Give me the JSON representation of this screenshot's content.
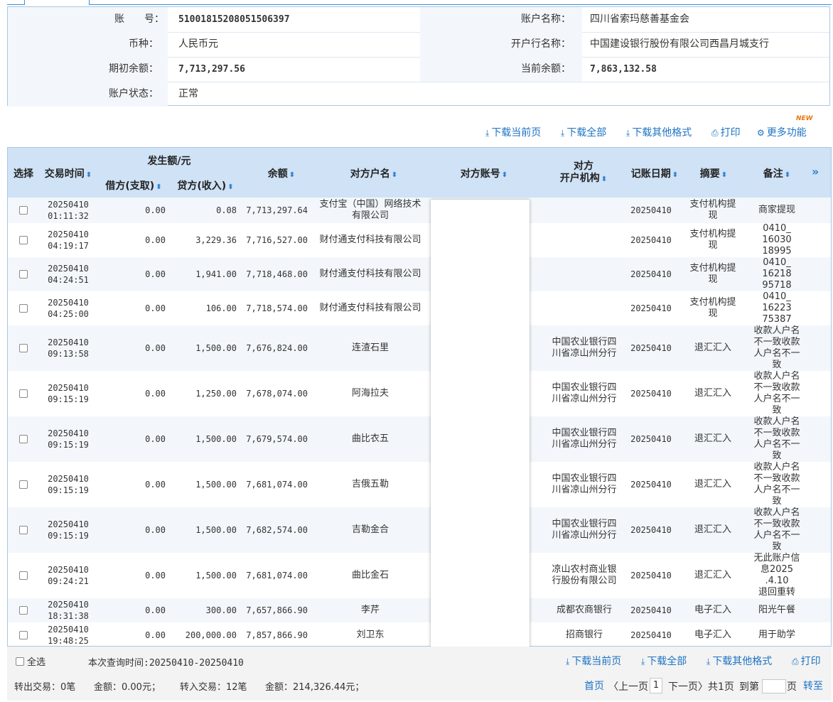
{
  "account": {
    "row1": {
      "l1": "账　　号：",
      "v1": "51001815208051506397",
      "l2": "账户名称：",
      "v2": "四川省索玛慈善基金会"
    },
    "row2": {
      "l1": "币种：",
      "v1": "人民币元",
      "l2": "开户行名称：",
      "v2": "中国建设银行股份有限公司西昌月城支行"
    },
    "row3": {
      "l1": "期初余额：",
      "v1": "7,713,297.56",
      "l2": "当前余额：",
      "v2": "7,863,132.58"
    },
    "row4": {
      "l1": "账户状态：",
      "v1": "正常"
    }
  },
  "toolbar": {
    "download_page": "下载当前页",
    "download_all": "下载全部",
    "download_other": "下载其他格式",
    "print": "打印",
    "more": "更多功能",
    "new_badge": "NEW"
  },
  "table": {
    "headers": {
      "select": "选择",
      "time": "交易时间",
      "amount_group": "发生额/元",
      "debit": "借方(支取)",
      "credit": "贷方(收入)",
      "balance": "余额",
      "counter_name": "对方户名",
      "counter_account": "对方账号",
      "counter_bank": "对方\n开户机构",
      "post_date": "记账日期",
      "summary": "摘要",
      "remark": "备注",
      "more": "»"
    },
    "rows": [
      {
        "time": "20250410\n01:11:32",
        "debit": "0.00",
        "credit": "0.08",
        "balance": "7,713,297.64",
        "name": "支付宝（中国）网络技术有限公司",
        "bank": "",
        "date": "20250410",
        "summary": "支付机构提现",
        "remark": "商家提现"
      },
      {
        "time": "20250410\n04:19:17",
        "debit": "0.00",
        "credit": "3,229.36",
        "balance": "7,716,527.00",
        "name": "财付通支付科技有限公司",
        "bank": "",
        "date": "20250410",
        "summary": "支付机构提现",
        "remark": "0410_\n16030\n18995"
      },
      {
        "time": "20250410\n04:24:51",
        "debit": "0.00",
        "credit": "1,941.00",
        "balance": "7,718,468.00",
        "name": "财付通支付科技有限公司",
        "bank": "",
        "date": "20250410",
        "summary": "支付机构提现",
        "remark": "0410_\n16218\n95718"
      },
      {
        "time": "20250410\n04:25:00",
        "debit": "0.00",
        "credit": "106.00",
        "balance": "7,718,574.00",
        "name": "财付通支付科技有限公司",
        "bank": "",
        "date": "20250410",
        "summary": "支付机构提现",
        "remark": "0410_\n16223\n75387"
      },
      {
        "time": "20250410\n09:13:58",
        "debit": "0.00",
        "credit": "1,500.00",
        "balance": "7,676,824.00",
        "name": "连渣石里",
        "bank": "中国农业银行四川省凉山州分行",
        "date": "20250410",
        "summary": "退汇汇入",
        "remark": "收款人户名不一致收款人户名不一致"
      },
      {
        "time": "20250410\n09:15:19",
        "debit": "0.00",
        "credit": "1,250.00",
        "balance": "7,678,074.00",
        "name": "阿海拉夫",
        "bank": "中国农业银行四川省凉山州分行",
        "date": "20250410",
        "summary": "退汇汇入",
        "remark": "收款人户名不一致收款人户名不一致"
      },
      {
        "time": "20250410\n09:15:19",
        "debit": "0.00",
        "credit": "1,500.00",
        "balance": "7,679,574.00",
        "name": "曲比衣五",
        "bank": "中国农业银行四川省凉山州分行",
        "date": "20250410",
        "summary": "退汇汇入",
        "remark": "收款人户名不一致收款人户名不一致"
      },
      {
        "time": "20250410\n09:15:19",
        "debit": "0.00",
        "credit": "1,500.00",
        "balance": "7,681,074.00",
        "name": "吉俄五勒",
        "bank": "中国农业银行四川省凉山州分行",
        "date": "20250410",
        "summary": "退汇汇入",
        "remark": "收款人户名不一致收款人户名不一致"
      },
      {
        "time": "20250410\n09:15:19",
        "debit": "0.00",
        "credit": "1,500.00",
        "balance": "7,682,574.00",
        "name": "吉勒金合",
        "bank": "中国农业银行四川省凉山州分行",
        "date": "20250410",
        "summary": "退汇汇入",
        "remark": "收款人户名不一致收款人户名不一致"
      },
      {
        "time": "20250410\n09:24:21",
        "debit": "0.00",
        "credit": "1,500.00",
        "balance": "7,681,074.00",
        "name": "曲比金石",
        "bank": "凉山农村商业银行股份有限公司",
        "date": "20250410",
        "summary": "退汇汇入",
        "remark": "无此账户信息2025\n.4.10\n退回重转"
      },
      {
        "time": "20250410\n18:31:38",
        "debit": "0.00",
        "credit": "300.00",
        "balance": "7,657,866.90",
        "name": "李芹",
        "bank": "成都农商银行",
        "date": "20250410",
        "summary": "电子汇入",
        "remark": "阳光午餐"
      },
      {
        "time": "20250410\n19:48:25",
        "debit": "0.00",
        "credit": "200,000.00",
        "balance": "7,857,866.90",
        "name": "刘卫东",
        "bank": "招商银行",
        "date": "20250410",
        "summary": "电子汇入",
        "remark": "用于助学"
      }
    ]
  },
  "footer": {
    "select_all": "全选",
    "query_time": "本次查询时间:20250410-20250410",
    "download_page": "下载当前页",
    "download_all": "下载全部",
    "download_other": "下载其他格式",
    "print": "打印",
    "out_tx": "转出交易：0笔",
    "out_amt": "金额：0.00元；",
    "in_tx": "转入交易：12笔",
    "in_amt": "金额：214,326.44元；",
    "first": "首页",
    "prev": "〈上一页",
    "page": "1",
    "next": "下一页〉",
    "total": "共1页",
    "goto": "到第",
    "page_unit": "页",
    "jump": "转至"
  }
}
